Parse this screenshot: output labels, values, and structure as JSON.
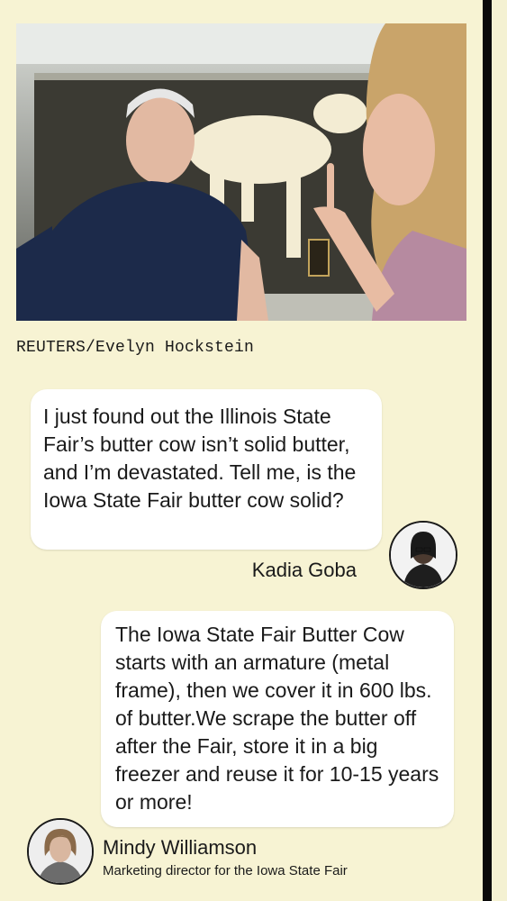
{
  "photo": {
    "alt": "Man in navy polo shirt beside a woman pointing at a butter cow sculpture behind glass"
  },
  "credit": "REUTERS/Evelyn Hockstein",
  "question": {
    "text": "I just found out the Illinois State Fair’s butter cow isn’t solid butter, and I’m devastated. Tell me, is the Iowa State Fair butter cow solid?",
    "author": "Kadia Goba"
  },
  "answer": {
    "text": "The Iowa State Fair Butter Cow starts with an armature (metal frame), then we cover it in 600 lbs. of butter.We scrape the butter off after the Fair, store it in a big freezer and reuse it for 10-15 years or more!",
    "author": "Mindy Williamson",
    "author_title": "Marketing director for the Iowa State Fair"
  },
  "colors": {
    "page_background": "#f7f3d3",
    "bubble_background": "#ffffff",
    "frame_background": "#0a0a0a"
  }
}
